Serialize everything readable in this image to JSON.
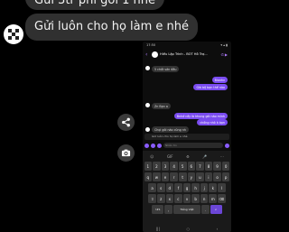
{
  "outer_chat": {
    "messages": [
      {
        "text": "Gửi 3tr phí gói 1 nhé"
      },
      {
        "text": "Gửi luôn cho họ làm e nhé"
      }
    ],
    "side_buttons": {
      "share_icon": "share-icon",
      "camera_icon": "camera-icon"
    }
  },
  "phone": {
    "status_time": "17:50",
    "status_right": "▾ ▴ ▮",
    "header": {
      "title": "Hiếu Lập Trình - BOT Hỗ Trợ..."
    },
    "messages": [
      {
        "side": "in",
        "text": "5 chốt sản đầu"
      },
      {
        "side": "out",
        "text": "Bianhv"
      },
      {
        "side": "out",
        "text": "Giá bộ bạn thế nào"
      },
      {
        "side": "in",
        "text": "Zn Bạn a"
      },
      {
        "side": "out",
        "text": "Bnhở cầy là khung gói nào mình"
      },
      {
        "side": "out",
        "text": "chống nhỏ à bạn"
      },
      {
        "side": "in",
        "text": "Chọi gói nào cũng nh"
      }
    ],
    "reply": "Giữ luôn cho họ làm e nhé",
    "input_placeholder": "Nhắn tin",
    "keyboard": {
      "toolbar": [
        "☺",
        "GIF",
        "⚙",
        "🎤",
        "⋯"
      ],
      "rows": [
        [
          "1",
          "2",
          "3",
          "4",
          "5",
          "6",
          "7",
          "8",
          "9",
          "0"
        ],
        [
          "q",
          "w",
          "e",
          "r",
          "t",
          "y",
          "u",
          "i",
          "o",
          "p"
        ],
        [
          "a",
          "s",
          "d",
          "f",
          "g",
          "h",
          "j",
          "k",
          "l"
        ],
        [
          "⇧",
          "z",
          "x",
          "c",
          "v",
          "b",
          "n",
          "m",
          "⌫"
        ]
      ],
      "bottom": [
        "!#1",
        ",",
        "Tiếng Việt",
        ".",
        "↵"
      ]
    },
    "nav": [
      "|||",
      "○",
      "‹"
    ]
  }
}
